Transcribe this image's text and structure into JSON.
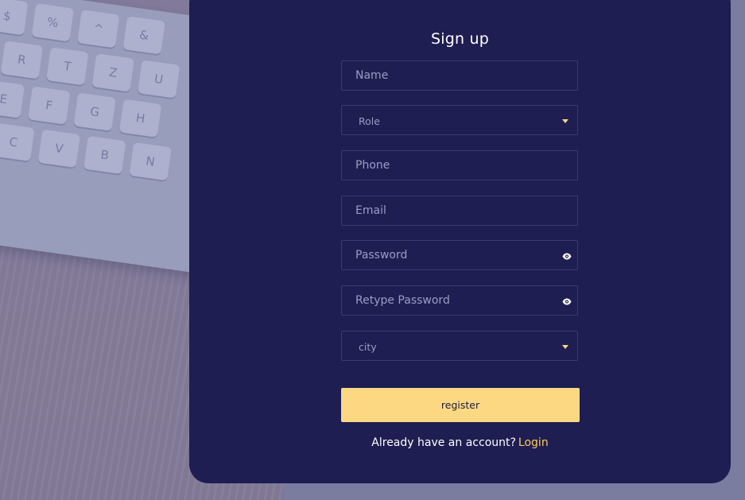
{
  "form": {
    "title": "Sign up",
    "name_placeholder": "Name",
    "role_select": {
      "value": "Role"
    },
    "phone_placeholder": "Phone",
    "email_placeholder": "Email",
    "password_placeholder": "Password",
    "retype_password_placeholder": "Retype Password",
    "city_select": {
      "value": "city"
    },
    "register_label": "register",
    "footer_text": "Already have an account?",
    "login_link": "Login"
  },
  "background_keys": [
    "$",
    "%",
    "^",
    "&",
    "R",
    "T",
    "Z",
    "U",
    "E",
    "F",
    "G",
    "H",
    "C",
    "V",
    "B",
    "N"
  ],
  "colors": {
    "card_bg": "#1e1e52",
    "accent": "#fdd883",
    "link": "#fdc95c",
    "page_bg": "#7a7ca0"
  },
  "icons": {
    "select_caret": "caret-down-icon",
    "password_toggle": "eye-icon"
  }
}
